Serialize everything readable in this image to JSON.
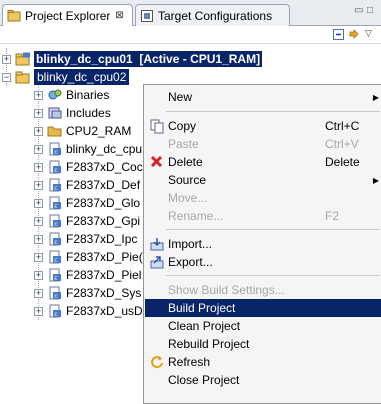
{
  "tabs": [
    {
      "label": "Project Explorer",
      "close": "⊠"
    },
    {
      "label": "Target Configurations"
    }
  ],
  "window_controls": {
    "minimize": "▭",
    "maximize": "□"
  },
  "tree": {
    "projects": [
      {
        "name": "blinky_dc_cpu01",
        "suffix": "[Active - CPU1_RAM]",
        "expander": "+"
      },
      {
        "name": "blinky_dc_cpu02",
        "expander": "−"
      }
    ],
    "children": [
      {
        "label": "Binaries",
        "icon": "binaries-icon"
      },
      {
        "label": "Includes",
        "icon": "includes-icon"
      },
      {
        "label": "CPU2_RAM",
        "icon": "folder-icon"
      },
      {
        "label": "blinky_dc_cpu",
        "icon": "c-file-icon"
      },
      {
        "label": "F2837xD_Coc",
        "icon": "c-file-icon"
      },
      {
        "label": "F2837xD_Def",
        "icon": "c-file-icon"
      },
      {
        "label": "F2837xD_Glo",
        "icon": "c-file-icon"
      },
      {
        "label": "F2837xD_Gpi",
        "icon": "c-file-icon"
      },
      {
        "label": "F2837xD_Ipc",
        "icon": "c-file-icon"
      },
      {
        "label": "F2837xD_Pie(",
        "icon": "c-file-icon"
      },
      {
        "label": "F2837xD_Piel",
        "icon": "c-file-icon"
      },
      {
        "label": "F2837xD_Sys",
        "icon": "c-file-icon"
      },
      {
        "label": "F2837xD_usD",
        "icon": "c-file-icon"
      }
    ]
  },
  "context_menu": {
    "items": [
      {
        "label": "New",
        "shortcut": "",
        "enabled": true,
        "icon": ""
      },
      {
        "label": "Copy",
        "shortcut": "Ctrl+C",
        "enabled": true,
        "icon": "copy-icon"
      },
      {
        "label": "Paste",
        "shortcut": "Ctrl+V",
        "enabled": false,
        "icon": ""
      },
      {
        "label": "Delete",
        "shortcut": "Delete",
        "enabled": true,
        "icon": "delete-icon"
      },
      {
        "label": "Source",
        "shortcut": "",
        "enabled": true,
        "icon": ""
      },
      {
        "label": "Move...",
        "shortcut": "",
        "enabled": false,
        "icon": ""
      },
      {
        "label": "Rename...",
        "shortcut": "F2",
        "enabled": false,
        "icon": ""
      },
      {
        "label": "Import...",
        "shortcut": "",
        "enabled": true,
        "icon": "import-icon"
      },
      {
        "label": "Export...",
        "shortcut": "",
        "enabled": true,
        "icon": "export-icon"
      },
      {
        "label": "Show Build Settings...",
        "shortcut": "",
        "enabled": false,
        "icon": ""
      },
      {
        "label": "Build Project",
        "shortcut": "",
        "enabled": true,
        "highlighted": true,
        "icon": ""
      },
      {
        "label": "Clean Project",
        "shortcut": "",
        "enabled": true,
        "icon": ""
      },
      {
        "label": "Rebuild Project",
        "shortcut": "",
        "enabled": true,
        "icon": ""
      },
      {
        "label": "Refresh",
        "shortcut": "",
        "enabled": true,
        "icon": "refresh-icon"
      },
      {
        "label": "Close Project",
        "shortcut": "",
        "enabled": true,
        "icon": ""
      }
    ]
  },
  "colors": {
    "selection": "#0a246a",
    "menu_background": "#f5f5f5",
    "disabled_text": "#a7a7a7",
    "delete_icon": "#d42020",
    "folder": "#e8b64a"
  }
}
